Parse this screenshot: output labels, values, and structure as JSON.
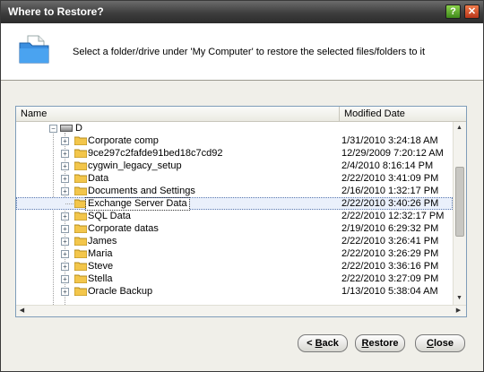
{
  "window": {
    "title": "Where to Restore?",
    "help_icon": "question-icon",
    "close_icon": "close-icon"
  },
  "header": {
    "instruction": "Select a folder/drive under 'My Computer' to restore the selected files/folders to it",
    "icon": "folder-icon"
  },
  "tree": {
    "columns": {
      "name": "Name",
      "modified": "Modified Date"
    },
    "drive": {
      "label": "D"
    },
    "rows": [
      {
        "name": "Corporate comp",
        "date": "1/31/2010 3:24:18 AM",
        "expandable": true
      },
      {
        "name": "9ce297c2fafde91bed18c7cd92",
        "date": "12/29/2009 7:20:12 AM",
        "expandable": true
      },
      {
        "name": "cygwin_legacy_setup",
        "date": "2/4/2010 8:16:14 PM",
        "expandable": true
      },
      {
        "name": "Data",
        "date": "2/22/2010 3:41:09 PM",
        "expandable": true
      },
      {
        "name": "Documents and Settings",
        "date": "2/16/2010 1:32:17 PM",
        "expandable": true
      },
      {
        "name": "Exchange Server Data",
        "date": "2/22/2010 3:40:26 PM",
        "expandable": false,
        "selected": true
      },
      {
        "name": "SQL Data",
        "date": "2/22/2010 12:32:17 PM",
        "expandable": true
      },
      {
        "name": "Corporate datas",
        "date": "2/19/2010 6:29:32 PM",
        "expandable": true
      },
      {
        "name": "James",
        "date": "2/22/2010 3:26:41 PM",
        "expandable": true
      },
      {
        "name": "Maria",
        "date": "2/22/2010 3:26:29 PM",
        "expandable": true
      },
      {
        "name": "Steve",
        "date": "2/22/2010 3:36:16 PM",
        "expandable": true
      },
      {
        "name": "Stella",
        "date": "2/22/2010 3:27:09 PM",
        "expandable": true
      },
      {
        "name": "Oracle Backup",
        "date": "1/13/2010 5:38:04 AM",
        "expandable": true
      }
    ]
  },
  "buttons": {
    "back_prefix": "< ",
    "back_mnemonic": "B",
    "back_rest": "ack",
    "restore_mnemonic": "R",
    "restore_rest": "estore",
    "close_mnemonic": "C",
    "close_rest": "lose"
  },
  "colors": {
    "selection": "#eaf0fb",
    "titlebar": "#3d3d3d",
    "folder": "#f3c64b"
  }
}
